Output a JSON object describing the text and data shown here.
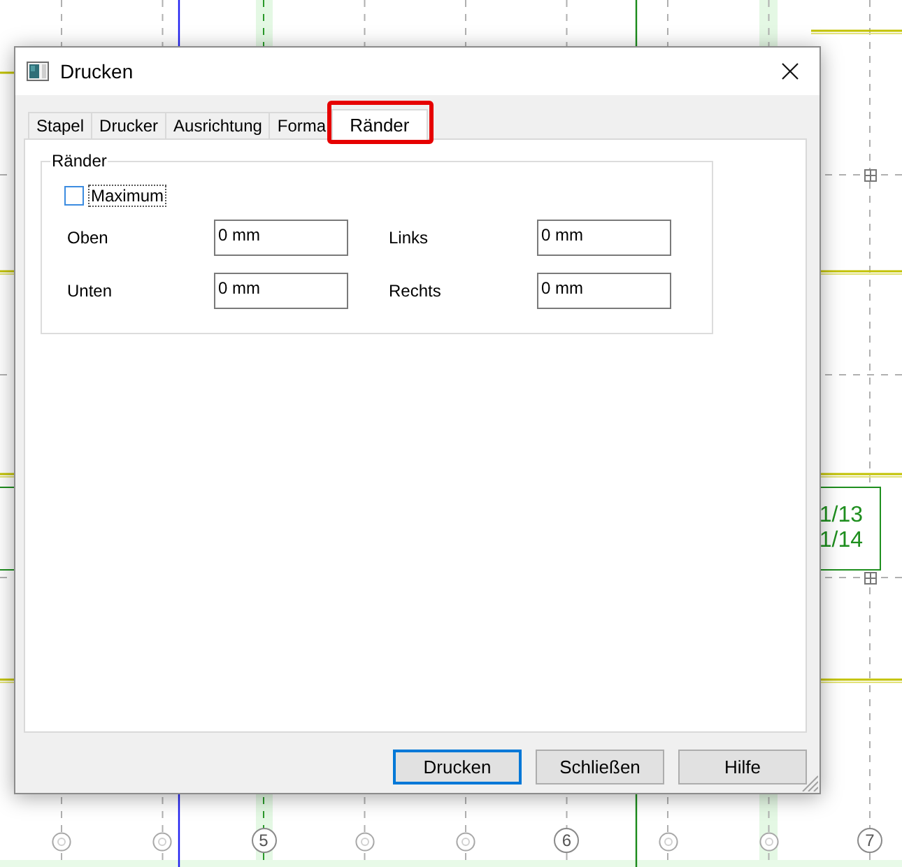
{
  "window": {
    "title": "Drucken"
  },
  "tabs": [
    {
      "label": "Stapel",
      "selected": false,
      "highlighted": false
    },
    {
      "label": "Drucker",
      "selected": false,
      "highlighted": false
    },
    {
      "label": "Ausrichtung",
      "selected": false,
      "highlighted": false
    },
    {
      "label": "Forma",
      "selected": false,
      "highlighted": false
    },
    {
      "label": "Ränder",
      "selected": true,
      "highlighted": true
    }
  ],
  "group": {
    "title": "Ränder",
    "checkbox": {
      "label": "Maximum",
      "checked": false
    },
    "fields": [
      {
        "label": "Oben",
        "value": "0 mm"
      },
      {
        "label": "Links",
        "value": "0 mm"
      },
      {
        "label": "Unten",
        "value": "0 mm"
      },
      {
        "label": "Rechts",
        "value": "0 mm"
      }
    ]
  },
  "buttons": [
    {
      "label": "Drucken",
      "focused": true
    },
    {
      "label": "Schließen",
      "focused": false
    },
    {
      "label": "Hilfe",
      "focused": false
    }
  ],
  "drawing": {
    "axis_markers": [
      {
        "kind": "minor"
      },
      {
        "kind": "minor"
      },
      {
        "kind": "major",
        "label": "5"
      },
      {
        "kind": "minor"
      },
      {
        "kind": "minor"
      },
      {
        "kind": "major",
        "label": "6"
      },
      {
        "kind": "minor"
      },
      {
        "kind": "minor"
      },
      {
        "kind": "major",
        "label": "7"
      }
    ],
    "tag": {
      "lines": [
        "1/13",
        "1/14"
      ]
    }
  }
}
